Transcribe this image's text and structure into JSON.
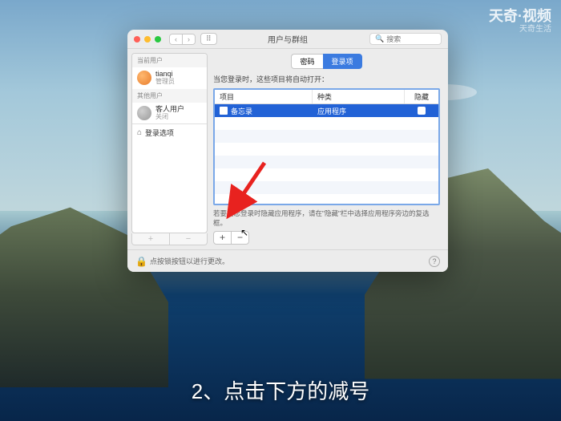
{
  "watermark": {
    "main": "天奇·视频",
    "sub": "天奇生活"
  },
  "window": {
    "title": "用户与群组",
    "nav": {
      "back": "‹",
      "forward": "›",
      "grid": "⠿"
    },
    "search_placeholder": "搜索"
  },
  "sidebar": {
    "sections": [
      {
        "header": "当前用户",
        "users": [
          {
            "name": "tianqi",
            "role": "管理员",
            "avatar": "orange"
          }
        ]
      },
      {
        "header": "其他用户",
        "users": [
          {
            "name": "客人用户",
            "role": "关闭",
            "avatar": "gray"
          }
        ]
      }
    ],
    "login_options": "登录选项",
    "add": "+",
    "remove": "−"
  },
  "main": {
    "tabs": [
      {
        "label": "密码",
        "active": false
      },
      {
        "label": "登录项",
        "active": true
      }
    ],
    "description": "当您登录时，这些项目将自动打开：",
    "columns": {
      "item": "项目",
      "kind": "种类",
      "hide": "隐藏"
    },
    "rows": [
      {
        "name": "备忘录",
        "kind": "应用程序",
        "hide": false,
        "selected": true
      }
    ],
    "hint": "若要在您登录时隐藏应用程序，请在\"隐藏\"栏中选择应用程序旁边的复选框。",
    "add": "+",
    "remove": "−"
  },
  "footer": {
    "lock_text": "点按锁按钮以进行更改。",
    "help": "?"
  },
  "caption": "2、点击下方的减号"
}
